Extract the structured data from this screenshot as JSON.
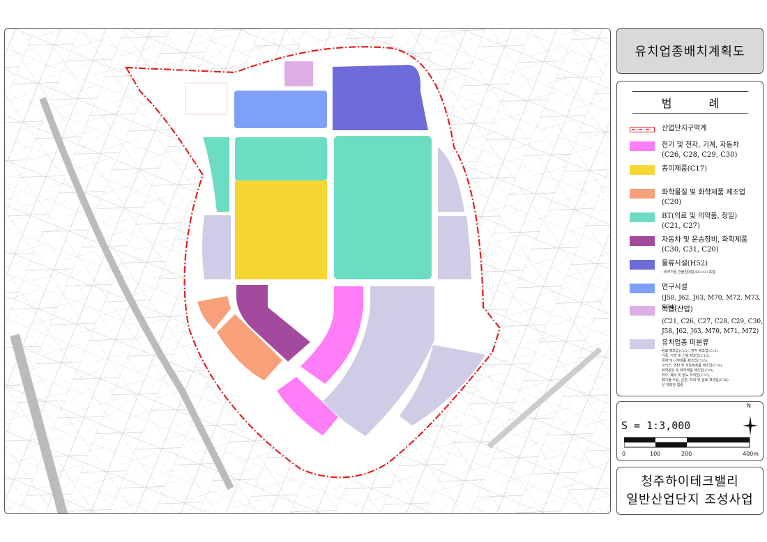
{
  "title": "유치업종배치계획도",
  "legend": {
    "heading": "범 례",
    "items": [
      {
        "key": "boundary",
        "label": "산업단지구역계",
        "color": "#e0201c"
      },
      {
        "key": "electric",
        "label": "전기 및 전자, 기계, 자동차\n(C26, C28, C29, C30)",
        "color": "#ff7df6"
      },
      {
        "key": "paper",
        "label": "종이제품(C17)",
        "color": "#f5d633"
      },
      {
        "key": "chemical",
        "label": "화학물질 및 화학제품 제조업\n(C20)",
        "color": "#f7a07a"
      },
      {
        "key": "bt",
        "label": "BT(의료 및 의약품, 정밀)\n(C21, C27)",
        "color": "#6cdcc3"
      },
      {
        "key": "auto",
        "label": "자동차 및 운송장비, 화학제품\n(C30, C31, C20)",
        "color": "#a44a9e"
      },
      {
        "key": "logistics",
        "label": "물류시설(H52)",
        "color": "#6d6ad9",
        "note": ": 비주거용 건물임대업(68112) 포함"
      },
      {
        "key": "research",
        "label": "연구시설",
        "color": "#7ea0f6",
        "codes": "(J58, J62, J63, M70, M72, M73, S94)"
      },
      {
        "key": "complex",
        "label": "복합(산업)",
        "color": "#ddaee6",
        "codes": "(C21, C26, C27, C28, C29, C30,\n  J58, J62, J63, M70, M71, M72)"
      },
      {
        "key": "nonspecific",
        "label": "유치업종 미분류",
        "color": "#cfcde6",
        "note": "음료 제조업(C11), 방적 제조업(C12),\n가죽, 가방 및 신발 제조업(C15),\n목재 및 나무제품 제조업(C16),\n코크스, 연탄 및 석유정제품 제조업(C19),\n화학섬유 및 화학제품 제조업(C20),\n하수, 폐수 및 분뇨 처리업(C37),\n폐기물 수집, 운반, 처리 및 원료 재생업(C38)\n은 제외한 업종"
      }
    ]
  },
  "scale": {
    "text": "S = 1:3,000",
    "ticks": [
      "0",
      "100",
      "200",
      "400m"
    ],
    "north_label": "N"
  },
  "project": {
    "line1": "청주하이테크밸리",
    "line2": "일반산업단지 조성사업"
  }
}
